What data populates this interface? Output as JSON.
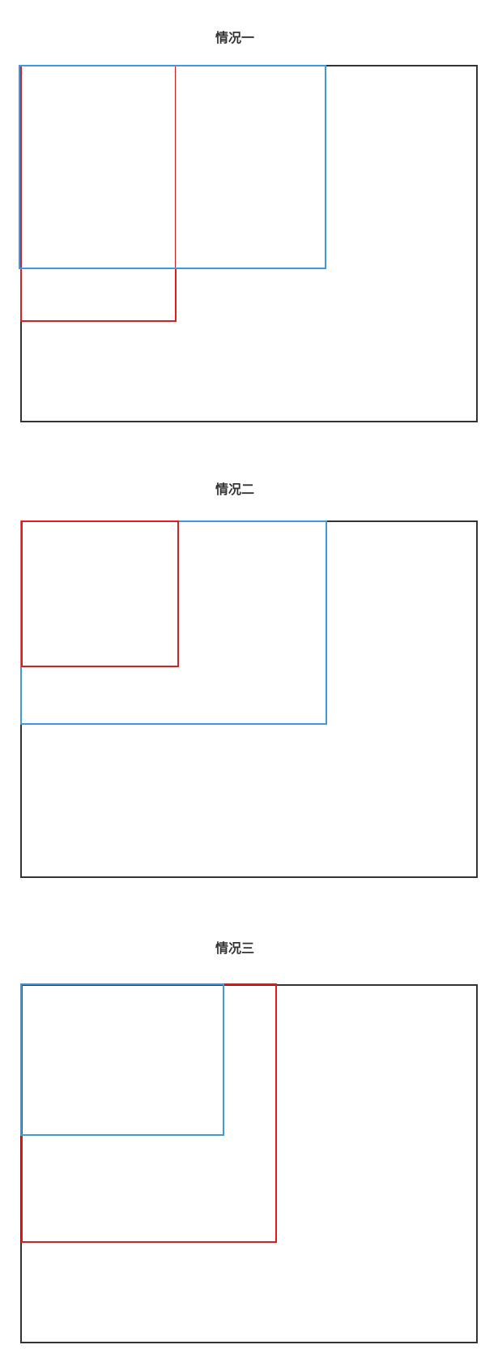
{
  "cases": [
    {
      "title": "情况一"
    },
    {
      "title": "情况二"
    },
    {
      "title": "情况三"
    }
  ],
  "colors": {
    "outer": "#333333",
    "red": "#e8191c",
    "blue": "#3a9ae8"
  }
}
